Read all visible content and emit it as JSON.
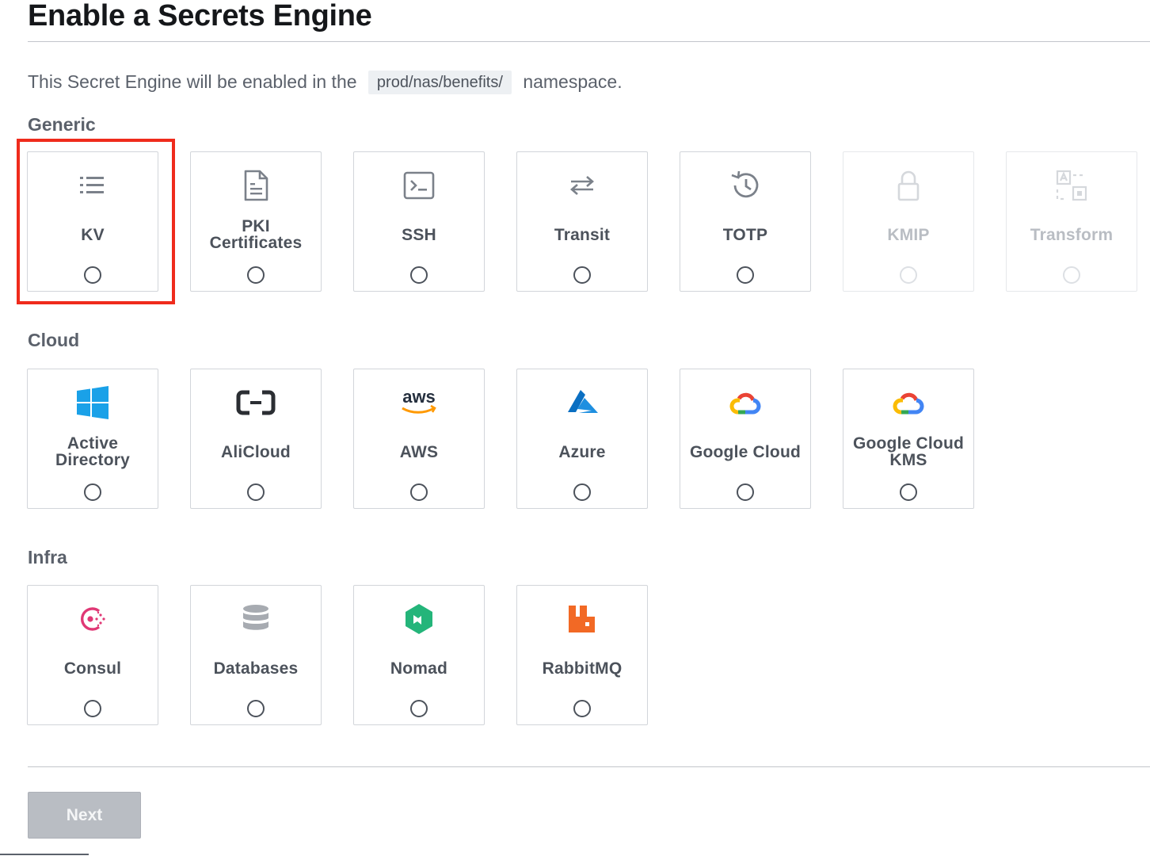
{
  "page": {
    "title": "Enable a Secrets Engine",
    "intro_prefix": "This Secret Engine will be enabled in the",
    "namespace": "prod/nas/benefits/",
    "intro_suffix": "namespace."
  },
  "sections": {
    "generic": {
      "label": "Generic",
      "cards": [
        {
          "label": "KV",
          "icon": "list-icon",
          "enabled": true,
          "selected": false
        },
        {
          "label": "PKI Certificates",
          "icon": "document-icon",
          "enabled": true,
          "selected": false
        },
        {
          "label": "SSH",
          "icon": "terminal-icon",
          "enabled": true,
          "selected": false
        },
        {
          "label": "Transit",
          "icon": "swap-arrows-icon",
          "enabled": true,
          "selected": false
        },
        {
          "label": "TOTP",
          "icon": "history-clock-icon",
          "enabled": true,
          "selected": false
        },
        {
          "label": "KMIP",
          "icon": "lock-icon",
          "enabled": false,
          "selected": false
        },
        {
          "label": "Transform",
          "icon": "transform-icon",
          "enabled": false,
          "selected": false
        }
      ]
    },
    "cloud": {
      "label": "Cloud",
      "cards": [
        {
          "label": "Active Directory",
          "icon": "windows-logo-icon",
          "enabled": true,
          "selected": false
        },
        {
          "label": "AliCloud",
          "icon": "alicloud-logo-icon",
          "enabled": true,
          "selected": false
        },
        {
          "label": "AWS",
          "icon": "aws-logo-icon",
          "icon_text": "aws",
          "enabled": true,
          "selected": false
        },
        {
          "label": "Azure",
          "icon": "azure-logo-icon",
          "enabled": true,
          "selected": false
        },
        {
          "label": "Google Cloud",
          "icon": "google-cloud-logo-icon",
          "enabled": true,
          "selected": false
        },
        {
          "label": "Google Cloud KMS",
          "icon": "google-cloud-logo-icon",
          "enabled": true,
          "selected": false
        }
      ]
    },
    "infra": {
      "label": "Infra",
      "cards": [
        {
          "label": "Consul",
          "icon": "consul-logo-icon",
          "enabled": true,
          "selected": false
        },
        {
          "label": "Databases",
          "icon": "database-icon",
          "enabled": true,
          "selected": false
        },
        {
          "label": "Nomad",
          "icon": "nomad-logo-icon",
          "enabled": true,
          "selected": false
        },
        {
          "label": "RabbitMQ",
          "icon": "rabbitmq-logo-icon",
          "enabled": true,
          "selected": false
        }
      ]
    }
  },
  "highlight": {
    "target": "KV",
    "color": "#ef2b1c"
  },
  "footer": {
    "next_label": "Next",
    "next_enabled": false
  },
  "colors": {
    "text_primary": "#15171a",
    "text_secondary": "#5b616b",
    "border": "#d2d5da",
    "disabled_text": "#b9bdc3",
    "button_disabled": "#b9bdc3",
    "namespace_bg": "#edf0f3"
  }
}
